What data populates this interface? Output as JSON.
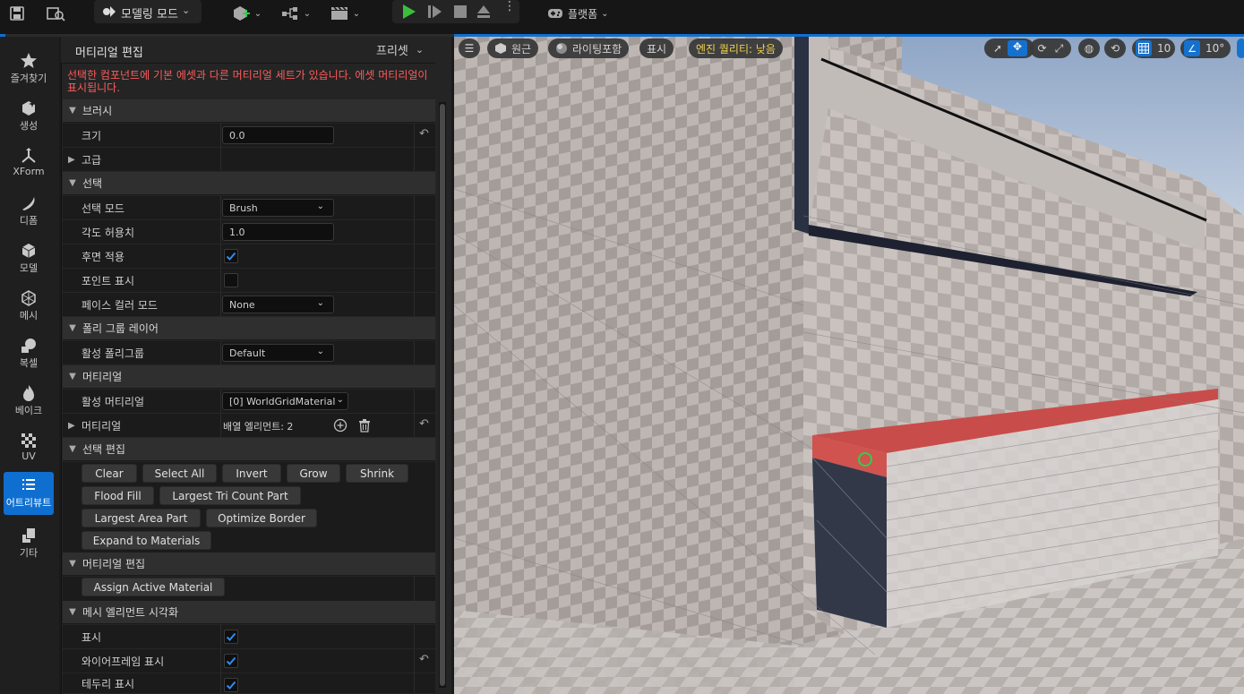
{
  "toolbar": {
    "mode_label": "모델링 모드",
    "platform_label": "플랫폼"
  },
  "modes": [
    {
      "label": "즐겨찾기",
      "icon": "star-icon"
    },
    {
      "label": "생성",
      "icon": "create-icon"
    },
    {
      "label": "XForm",
      "icon": "xform-icon"
    },
    {
      "label": "디폼",
      "icon": "deform-icon"
    },
    {
      "label": "모델",
      "icon": "model-icon"
    },
    {
      "label": "메시",
      "icon": "mesh-icon"
    },
    {
      "label": "복셀",
      "icon": "voxel-icon"
    },
    {
      "label": "베이크",
      "icon": "bake-icon"
    },
    {
      "label": "UV",
      "icon": "uv-icon"
    },
    {
      "label": "어트리뷰트",
      "icon": "attribute-icon"
    },
    {
      "label": "기타",
      "icon": "misc-icon"
    }
  ],
  "panel": {
    "title": "머티리얼 편집",
    "preset_label": "프리셋",
    "warning": "선택한 컴포넌트에 기본 에셋과 다른 머티리얼 세트가 있습니다. 에셋 머티리얼이 표시됩니다.",
    "sections": {
      "brush": "브러시",
      "selection": "선택",
      "polygroup_layer": "폴리 그룹 레이어",
      "material": "머티리얼",
      "selection_edit": "선택 편집",
      "material_edit": "머티리얼 편집",
      "mesh_viz": "메시 엘리먼트 시각화"
    },
    "rows": {
      "size_label": "크기",
      "size_value": "0.0",
      "advanced_label": "고급",
      "select_mode_label": "선택 모드",
      "select_mode_value": "Brush",
      "angle_label": "각도 허용치",
      "angle_value": "1.0",
      "backface_label": "후면 적용",
      "show_points_label": "포인트 표시",
      "face_color_label": "페이스 컬러 모드",
      "face_color_value": "None",
      "active_polygroup_label": "활성 폴리그룹",
      "active_polygroup_value": "Default",
      "active_material_label": "활성 머티리얼",
      "active_material_value": "[0] WorldGridMaterial",
      "materials_label": "머티리얼",
      "materials_value": "배열 엘리먼트: 2",
      "show_label": "표시",
      "wireframe_label": "와이어프레임 표시",
      "border_label": "테두리 표시"
    },
    "checks": {
      "backface": true,
      "show_points": false,
      "show": true,
      "wireframe": true,
      "border": true
    },
    "buttons": {
      "clear": "Clear",
      "select_all": "Select All",
      "invert": "Invert",
      "grow": "Grow",
      "shrink": "Shrink",
      "flood_fill": "Flood Fill",
      "largest_tri": "Largest Tri Count Part",
      "largest_area": "Largest Area Part",
      "optimize_border": "Optimize Border",
      "expand_materials": "Expand to Materials",
      "assign_material": "Assign Active Material"
    }
  },
  "viewport": {
    "perspective": "원근",
    "lighting": "라이팅포함",
    "show": "표시",
    "quality": "엔진 퀄리티: 낮음",
    "grid_value": "10",
    "angle_value": "10°"
  },
  "colors": {
    "accent": "#0f6fd0",
    "warning": "#ff5b5b",
    "quality_text": "#f2d34a",
    "selection": "#c94a48"
  }
}
